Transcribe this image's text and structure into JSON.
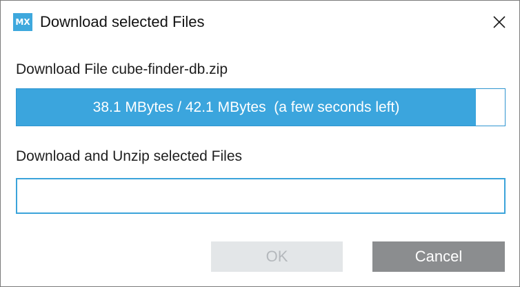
{
  "window": {
    "app_icon_text": "MX",
    "title": "Download selected Files",
    "close_icon": "close-icon"
  },
  "download": {
    "file_label": "Download File cube-finder-db.zip",
    "progress_text": "38.1 MBytes / 42.1 MBytes  (a few seconds left)",
    "downloaded_mb": 38.1,
    "total_mb": 42.1,
    "progress_fraction": 0.94
  },
  "unzip": {
    "label": "Download and Unzip selected Files",
    "value": ""
  },
  "buttons": {
    "ok_label": "OK",
    "ok_enabled": false,
    "cancel_label": "Cancel"
  },
  "colors": {
    "accent": "#3ba5dd",
    "ok_disabled_bg": "#e3e6e8",
    "cancel_bg": "#8b8d8f"
  }
}
